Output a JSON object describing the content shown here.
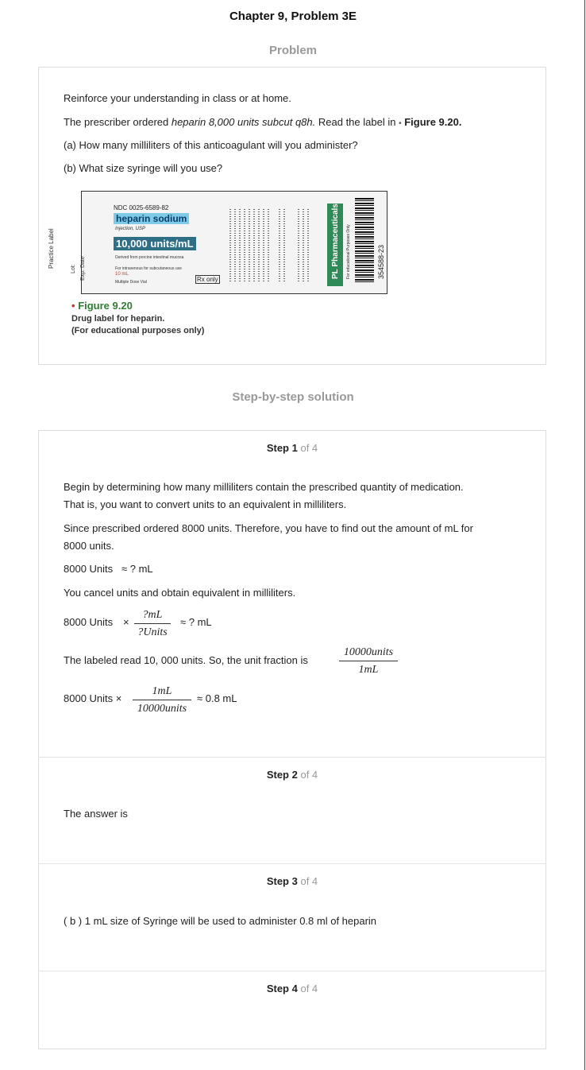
{
  "header": {
    "title": "Chapter 9, Problem 3E"
  },
  "problem": {
    "heading": "Problem",
    "intro": "Reinforce your understanding in class or at home.",
    "prescriber_a": "The prescriber ordered ",
    "prescriber_order": "heparin 8,000 units subcut q8h.",
    "prescriber_b": " Read the label in ",
    "bullet": "•",
    "prescriber_fig": "Figure 9.20.",
    "question_a": "(a) How many milliliters of this anticoagulant will you administer?",
    "question_b": "(b) What size syringe will you use?"
  },
  "drug_label": {
    "side_label": "Practice Label",
    "lot": "Lot:",
    "exp": "Exp. Date",
    "ndc": "NDC 0025-6589-82",
    "name": "heparin sodium",
    "injection": "Injection, USP",
    "concentration": "10,000 units/mL",
    "derived": "Derived from porcine intestinal mucosa",
    "route": "For intravenous for subcutaneous use",
    "volume": "10 mL",
    "vial": "Multiple Dose Vial",
    "rx": "Rx only",
    "manufacturer": "PL Pharmaceuticals",
    "edu": "For educational Purposes Only",
    "barcode_number": "354588-23",
    "logo_colors": {
      "green": "#2e8b57",
      "name_bg": "#7ecbe8",
      "conc_bg": "#2f6f86"
    }
  },
  "figure": {
    "title": "Figure 9.20",
    "caption_1": "Drug label for heparin.",
    "caption_2": "(For educational purposes only)"
  },
  "solution": {
    "heading": "Step-by-step solution",
    "steps": [
      {
        "label": "Step 1",
        "of": "of 4"
      },
      {
        "label": "Step 2",
        "of": "of 4"
      },
      {
        "label": "Step 3",
        "of": "of 4"
      },
      {
        "label": "Step 4",
        "of": "of 4"
      }
    ],
    "step1": {
      "p1_line1": "Begin by determining how many milliliters contain the prescribed quantity of medication.",
      "p1_line2": "That is, you want to convert units to an equivalent in milliliters.",
      "p2_line1": "Since prescribed ordered 8000 units. Therefore, you have to find out the amount of mL for",
      "p2_line2": "8000 units.",
      "eq1_left": "8000 Units",
      "approx": "≈",
      "eq1_right": "? mL",
      "p3": "You cancel units and obtain equivalent in milliliters.",
      "eq2_left": "8000 Units",
      "times": "×",
      "eq2_num": "?mL",
      "eq2_den": "?Units",
      "eq2_right": "≈ ? mL",
      "p4": "The labeled read 10, 000 units. So, the unit fraction is",
      "frac_num": "10000units",
      "frac_den": "1mL",
      "eq3_left": "8000 Units ×",
      "eq3_num": "1mL",
      "eq3_den": "10000units",
      "eq3_right": "≈ 0.8 mL"
    },
    "step2": {
      "text": "The answer is"
    },
    "step3": {
      "text": "( b ) 1 mL size of Syringe will be used to administer 0.8 ml of heparin"
    }
  }
}
